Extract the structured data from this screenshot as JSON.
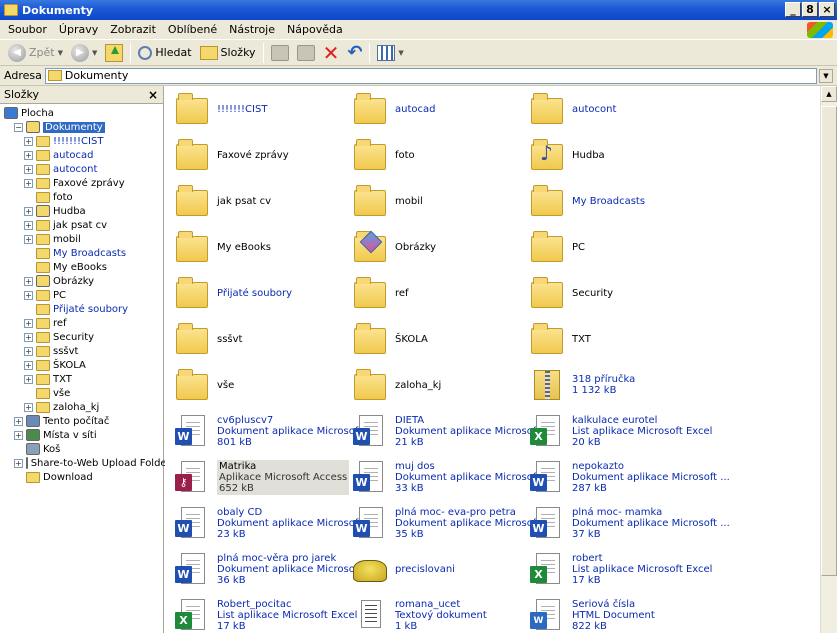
{
  "window": {
    "title": "Dokumenty",
    "buttons": [
      "_",
      "8",
      "×"
    ]
  },
  "menu": [
    "Soubor",
    "Úpravy",
    "Zobrazit",
    "Oblíbené",
    "Nástroje",
    "Nápověda"
  ],
  "toolbar": {
    "back": "Zpět",
    "search": "Hledat",
    "folders": "Složky"
  },
  "address": {
    "label": "Adresa",
    "value": "Dokumenty"
  },
  "tree": {
    "title": "Složky",
    "close": "×",
    "rows": [
      {
        "label": "Plocha",
        "indent": 0,
        "expand": "",
        "icon": "desktop"
      },
      {
        "label": "Dokumenty",
        "indent": 1,
        "expand": "−",
        "icon": "docs",
        "selected": true
      },
      {
        "label": "!!!!!!!CIST",
        "indent": 2,
        "expand": "+",
        "icon": "folder",
        "link": true
      },
      {
        "label": "autocad",
        "indent": 2,
        "expand": "+",
        "icon": "folder",
        "link": true
      },
      {
        "label": "autocont",
        "indent": 2,
        "expand": "+",
        "icon": "folder",
        "link": true
      },
      {
        "label": "Faxové zprávy",
        "indent": 2,
        "expand": "+",
        "icon": "folder"
      },
      {
        "label": "foto",
        "indent": 2,
        "expand": "",
        "icon": "folder"
      },
      {
        "label": "Hudba",
        "indent": 2,
        "expand": "+",
        "icon": "music"
      },
      {
        "label": "jak psat cv",
        "indent": 2,
        "expand": "+",
        "icon": "folder"
      },
      {
        "label": "mobil",
        "indent": 2,
        "expand": "+",
        "icon": "folder"
      },
      {
        "label": "My Broadcasts",
        "indent": 2,
        "expand": "",
        "icon": "folder",
        "link": true
      },
      {
        "label": "My eBooks",
        "indent": 2,
        "expand": "",
        "icon": "folder"
      },
      {
        "label": "Obrázky",
        "indent": 2,
        "expand": "+",
        "icon": "pics"
      },
      {
        "label": "PC",
        "indent": 2,
        "expand": "+",
        "icon": "folder"
      },
      {
        "label": "Přijaté soubory",
        "indent": 2,
        "expand": "",
        "icon": "folder",
        "link": true
      },
      {
        "label": "ref",
        "indent": 2,
        "expand": "+",
        "icon": "folder"
      },
      {
        "label": "Security",
        "indent": 2,
        "expand": "+",
        "icon": "folder"
      },
      {
        "label": "ssšvt",
        "indent": 2,
        "expand": "+",
        "icon": "folder"
      },
      {
        "label": "ŠKOLA",
        "indent": 2,
        "expand": "+",
        "icon": "folder"
      },
      {
        "label": "TXT",
        "indent": 2,
        "expand": "+",
        "icon": "folder"
      },
      {
        "label": "vše",
        "indent": 2,
        "expand": "",
        "icon": "folder"
      },
      {
        "label": "zaloha_kj",
        "indent": 2,
        "expand": "+",
        "icon": "folder"
      },
      {
        "label": "Tento počítač",
        "indent": 1,
        "expand": "+",
        "icon": "computer"
      },
      {
        "label": "Místa v síti",
        "indent": 1,
        "expand": "+",
        "icon": "network"
      },
      {
        "label": "Koš",
        "indent": 1,
        "expand": "",
        "icon": "bin"
      },
      {
        "label": "Share-to-Web Upload Folder",
        "indent": 1,
        "expand": "+",
        "icon": "web"
      },
      {
        "label": "Download",
        "indent": 1,
        "expand": "",
        "icon": "folder"
      }
    ]
  },
  "items": [
    {
      "name": "!!!!!!!CIST",
      "type": "folder",
      "link": true
    },
    {
      "name": "autocad",
      "type": "folder",
      "link": true
    },
    {
      "name": "autocont",
      "type": "folder",
      "link": true
    },
    {
      "name": "Faxové zprávy",
      "type": "folder"
    },
    {
      "name": "foto",
      "type": "folder"
    },
    {
      "name": "Hudba",
      "type": "music"
    },
    {
      "name": "jak psat cv",
      "type": "folder"
    },
    {
      "name": "mobil",
      "type": "folder"
    },
    {
      "name": "My Broadcasts",
      "type": "folder",
      "link": true
    },
    {
      "name": "My eBooks",
      "type": "folder"
    },
    {
      "name": "Obrázky",
      "type": "pics"
    },
    {
      "name": "PC",
      "type": "folder"
    },
    {
      "name": "Přijaté soubory",
      "type": "folder",
      "link": true
    },
    {
      "name": "ref",
      "type": "folder"
    },
    {
      "name": "Security",
      "type": "folder"
    },
    {
      "name": "ssšvt",
      "type": "folder"
    },
    {
      "name": "ŠKOLA",
      "type": "folder"
    },
    {
      "name": "TXT",
      "type": "folder"
    },
    {
      "name": "vše",
      "type": "folder"
    },
    {
      "name": "zaloha_kj",
      "type": "folder"
    },
    {
      "name": "318 příručka",
      "type": "zip",
      "link": true,
      "size": "1 132 kB"
    },
    {
      "name": "cv6pluscv7",
      "type": "word",
      "link": true,
      "desc": "Dokument aplikace Microsoft ...",
      "size": "801 kB"
    },
    {
      "name": "DIETA",
      "type": "word",
      "link": true,
      "desc": "Dokument aplikace Microsoft ...",
      "size": "21 kB"
    },
    {
      "name": "kalkulace eurotel",
      "type": "excel",
      "link": true,
      "desc": "List aplikace Microsoft Excel",
      "size": "20 kB"
    },
    {
      "name": "Matrika",
      "type": "access",
      "desc": "Aplikace Microsoft Access",
      "size": "652 kB",
      "highlight": true
    },
    {
      "name": "muj dos",
      "type": "word",
      "link": true,
      "desc": "Dokument aplikace Microsoft ...",
      "size": "33 kB"
    },
    {
      "name": "nepokazto",
      "type": "word",
      "link": true,
      "desc": "Dokument aplikace Microsoft ...",
      "size": "287 kB"
    },
    {
      "name": "obaly CD",
      "type": "word",
      "link": true,
      "desc": "Dokument aplikace Microsoft ...",
      "size": "23 kB"
    },
    {
      "name": "plná moc- eva-pro petra",
      "type": "word",
      "link": true,
      "desc": "Dokument aplikace Microsoft ...",
      "size": "35 kB"
    },
    {
      "name": "plná moc- mamka",
      "type": "word",
      "link": true,
      "desc": "Dokument aplikace Microsoft ...",
      "size": "37 kB"
    },
    {
      "name": "plná moc-věra pro jarek",
      "type": "word",
      "link": true,
      "desc": "Dokument aplikace Microsoft ...",
      "size": "36 kB"
    },
    {
      "name": "precislovani",
      "type": "phone",
      "link": true
    },
    {
      "name": "robert",
      "type": "excel",
      "link": true,
      "desc": "List aplikace Microsoft Excel",
      "size": "17 kB"
    },
    {
      "name": "Robert_pocitac",
      "type": "excel",
      "link": true,
      "desc": "List aplikace Microsoft Excel",
      "size": "17 kB"
    },
    {
      "name": "romana_ucet",
      "type": "text",
      "link": true,
      "desc": "Textový dokument",
      "size": "1 kB"
    },
    {
      "name": "Seriová čísla",
      "type": "html",
      "link": true,
      "desc": "HTML Document",
      "size": "822 kB"
    }
  ]
}
